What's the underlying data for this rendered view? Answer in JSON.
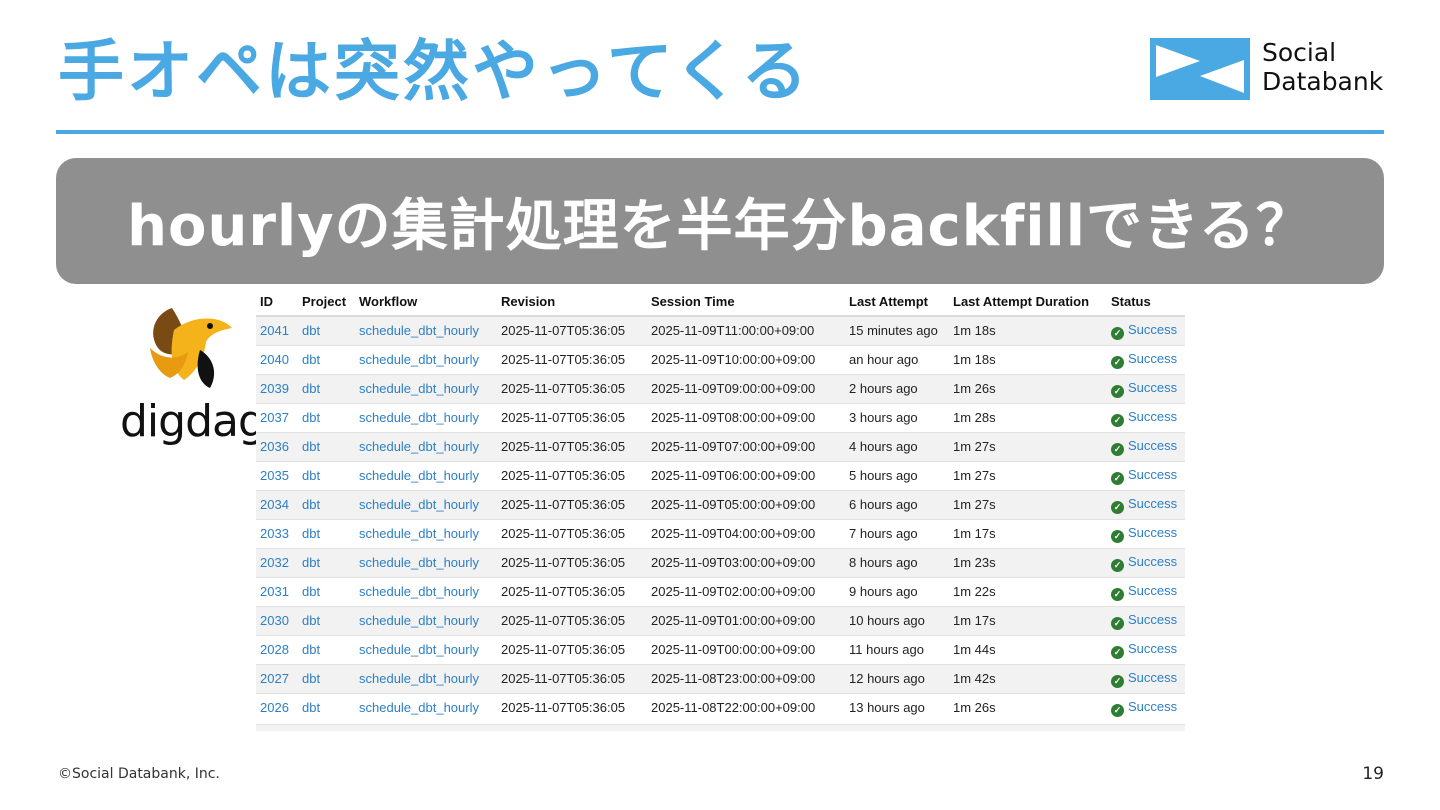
{
  "slide": {
    "title": "手オペは突然やってくる",
    "banner": "hourlyの集計処理を半年分backfillできる？",
    "copyright": "©Social Databank, Inc.",
    "page_number": "19"
  },
  "logo": {
    "line1": "Social",
    "line2": "Databank",
    "icon": "social-databank-bowtie-logo",
    "color": "#4aa8e3"
  },
  "digdag": {
    "word": "digdag",
    "icon": "digdag-bird-mascot"
  },
  "colors": {
    "accent": "#4aa8e3",
    "banner_bg": "#8f8f8f",
    "link": "#2c7fc6",
    "success": "#2e7d32"
  },
  "table": {
    "columns": [
      "ID",
      "Project",
      "Workflow",
      "Revision",
      "Session Time",
      "Last Attempt",
      "Last Attempt Duration",
      "Status"
    ],
    "rows": [
      {
        "id": "2041",
        "project": "dbt",
        "workflow": "schedule_dbt_hourly",
        "revision": "2025-11-07T05:36:05",
        "session_time": "2025-11-09T11:00:00+09:00",
        "last_attempt": "15 minutes ago",
        "duration": "1m 18s",
        "status": "Success"
      },
      {
        "id": "2040",
        "project": "dbt",
        "workflow": "schedule_dbt_hourly",
        "revision": "2025-11-07T05:36:05",
        "session_time": "2025-11-09T10:00:00+09:00",
        "last_attempt": "an hour ago",
        "duration": "1m 18s",
        "status": "Success"
      },
      {
        "id": "2039",
        "project": "dbt",
        "workflow": "schedule_dbt_hourly",
        "revision": "2025-11-07T05:36:05",
        "session_time": "2025-11-09T09:00:00+09:00",
        "last_attempt": "2 hours ago",
        "duration": "1m 26s",
        "status": "Success"
      },
      {
        "id": "2037",
        "project": "dbt",
        "workflow": "schedule_dbt_hourly",
        "revision": "2025-11-07T05:36:05",
        "session_time": "2025-11-09T08:00:00+09:00",
        "last_attempt": "3 hours ago",
        "duration": "1m 28s",
        "status": "Success"
      },
      {
        "id": "2036",
        "project": "dbt",
        "workflow": "schedule_dbt_hourly",
        "revision": "2025-11-07T05:36:05",
        "session_time": "2025-11-09T07:00:00+09:00",
        "last_attempt": "4 hours ago",
        "duration": "1m 27s",
        "status": "Success"
      },
      {
        "id": "2035",
        "project": "dbt",
        "workflow": "schedule_dbt_hourly",
        "revision": "2025-11-07T05:36:05",
        "session_time": "2025-11-09T06:00:00+09:00",
        "last_attempt": "5 hours ago",
        "duration": "1m 27s",
        "status": "Success"
      },
      {
        "id": "2034",
        "project": "dbt",
        "workflow": "schedule_dbt_hourly",
        "revision": "2025-11-07T05:36:05",
        "session_time": "2025-11-09T05:00:00+09:00",
        "last_attempt": "6 hours ago",
        "duration": "1m 27s",
        "status": "Success"
      },
      {
        "id": "2033",
        "project": "dbt",
        "workflow": "schedule_dbt_hourly",
        "revision": "2025-11-07T05:36:05",
        "session_time": "2025-11-09T04:00:00+09:00",
        "last_attempt": "7 hours ago",
        "duration": "1m 17s",
        "status": "Success"
      },
      {
        "id": "2032",
        "project": "dbt",
        "workflow": "schedule_dbt_hourly",
        "revision": "2025-11-07T05:36:05",
        "session_time": "2025-11-09T03:00:00+09:00",
        "last_attempt": "8 hours ago",
        "duration": "1m 23s",
        "status": "Success"
      },
      {
        "id": "2031",
        "project": "dbt",
        "workflow": "schedule_dbt_hourly",
        "revision": "2025-11-07T05:36:05",
        "session_time": "2025-11-09T02:00:00+09:00",
        "last_attempt": "9 hours ago",
        "duration": "1m 22s",
        "status": "Success"
      },
      {
        "id": "2030",
        "project": "dbt",
        "workflow": "schedule_dbt_hourly",
        "revision": "2025-11-07T05:36:05",
        "session_time": "2025-11-09T01:00:00+09:00",
        "last_attempt": "10 hours ago",
        "duration": "1m 17s",
        "status": "Success"
      },
      {
        "id": "2028",
        "project": "dbt",
        "workflow": "schedule_dbt_hourly",
        "revision": "2025-11-07T05:36:05",
        "session_time": "2025-11-09T00:00:00+09:00",
        "last_attempt": "11 hours ago",
        "duration": "1m 44s",
        "status": "Success"
      },
      {
        "id": "2027",
        "project": "dbt",
        "workflow": "schedule_dbt_hourly",
        "revision": "2025-11-07T05:36:05",
        "session_time": "2025-11-08T23:00:00+09:00",
        "last_attempt": "12 hours ago",
        "duration": "1m 42s",
        "status": "Success"
      },
      {
        "id": "2026",
        "project": "dbt",
        "workflow": "schedule_dbt_hourly",
        "revision": "2025-11-07T05:36:05",
        "session_time": "2025-11-08T22:00:00+09:00",
        "last_attempt": "13 hours ago",
        "duration": "1m 26s",
        "status": "Success"
      }
    ]
  }
}
